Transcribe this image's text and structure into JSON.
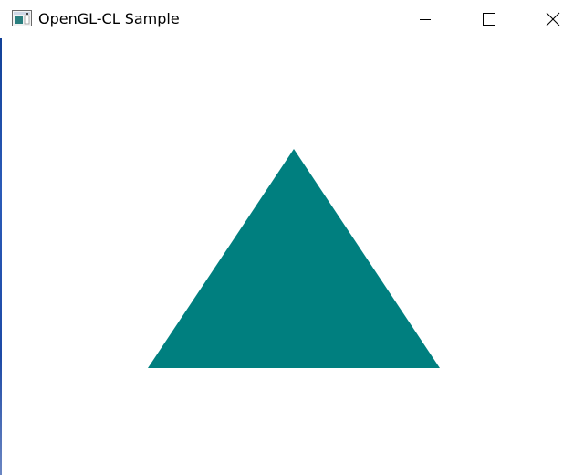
{
  "window": {
    "title": "OpenGL-CL Sample"
  },
  "caption_buttons": {
    "minimize_icon": "minimize-icon",
    "maximize_icon": "maximize-icon",
    "close_icon": "close-icon"
  },
  "canvas": {
    "background_color": "#ffffff",
    "shape": "triangle",
    "fill_color": "#007f7f"
  }
}
